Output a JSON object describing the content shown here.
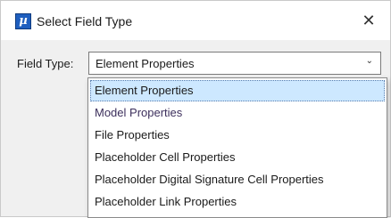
{
  "window": {
    "title": "Select Field Type",
    "icon": "app-logo-icon",
    "icon_glyph": "µ",
    "close_glyph": "✕"
  },
  "field_type": {
    "label": "Field Type:",
    "selected_value": "Element Properties",
    "chevron_glyph": "⌄"
  },
  "dropdown": {
    "options": [
      {
        "label": "Element Properties",
        "selected": true
      },
      {
        "label": "Model Properties",
        "selected": false
      },
      {
        "label": "File Properties",
        "selected": false
      },
      {
        "label": "Placeholder Cell Properties",
        "selected": false
      },
      {
        "label": "Placeholder Digital Signature Cell Properties",
        "selected": false
      },
      {
        "label": "Placeholder Link Properties",
        "selected": false
      }
    ]
  },
  "colors": {
    "selection_bg": "#cde8ff",
    "icon_blue": "#1f5fbf"
  }
}
